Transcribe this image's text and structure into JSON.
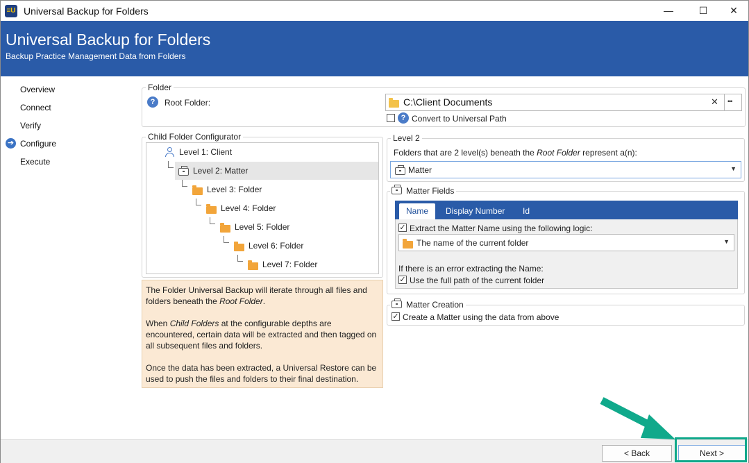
{
  "window": {
    "title": "Universal Backup for Folders",
    "app_icon": "≡U",
    "minimize": "—",
    "maximize": "☐",
    "close": "✕"
  },
  "banner": {
    "title": "Universal Backup for Folders",
    "subtitle": "Backup Practice Management Data from Folders"
  },
  "nav": {
    "items": [
      "Overview",
      "Connect",
      "Verify",
      "Configure",
      "Execute"
    ],
    "active": "Configure"
  },
  "folder_group": {
    "legend": "Folder",
    "root_label": "Root Folder:",
    "root_value": "C:\\Client Documents",
    "clear_glyph": "✕",
    "browse_glyph": "•••",
    "convert_label": "Convert to Universal Path",
    "convert_checked": false
  },
  "configurator": {
    "legend": "Child Folder Configurator",
    "levels": [
      "Level 1: Client",
      "Level 2: Matter",
      "Level 3: Folder",
      "Level 4: Folder",
      "Level 5: Folder",
      "Level 6: Folder",
      "Level 7: Folder"
    ],
    "selected_index": 1
  },
  "info": {
    "p1_a": "The Folder Universal Backup will iterate through all files and folders beneath the ",
    "p1_em": "Root Folder",
    "p1_b": ".",
    "p2_a": "When ",
    "p2_em": "Child Folders",
    "p2_b": " at the configurable depths are encountered, certain data will be extracted and then tagged on all subsequent files and folders.",
    "p3": "Once the data has been extracted, a Universal Restore can be used to push the files and folders to their final destination."
  },
  "level2": {
    "legend": "Level 2",
    "desc_a": "Folders that are 2 level(s) beneath the ",
    "desc_em": "Root Folder",
    "desc_b": " represent a(n):",
    "selected": "Matter"
  },
  "matter_fields": {
    "legend": "Matter Fields",
    "tabs": [
      "Name",
      "Display Number",
      "Id"
    ],
    "active_tab": "Name",
    "extract_label": "Extract the Matter Name using the following logic:",
    "extract_checked": true,
    "logic_selected": "The name of the current folder",
    "error_label": "If there is an error extracting the Name:",
    "full_path_label": "Use the full path of the current folder",
    "full_path_checked": true
  },
  "matter_creation": {
    "legend": "Matter Creation",
    "create_label": "Create a Matter using the data from above",
    "create_checked": true
  },
  "footer": {
    "back_label": "< Back",
    "next_label": "Next >"
  },
  "colors": {
    "banner": "#2a5ba8",
    "highlight": "#10a98b",
    "info_bg": "#fbe9d4"
  },
  "icons": {
    "help": "?",
    "nav_active": "➔",
    "dropdown": "▼",
    "check": "✓"
  }
}
